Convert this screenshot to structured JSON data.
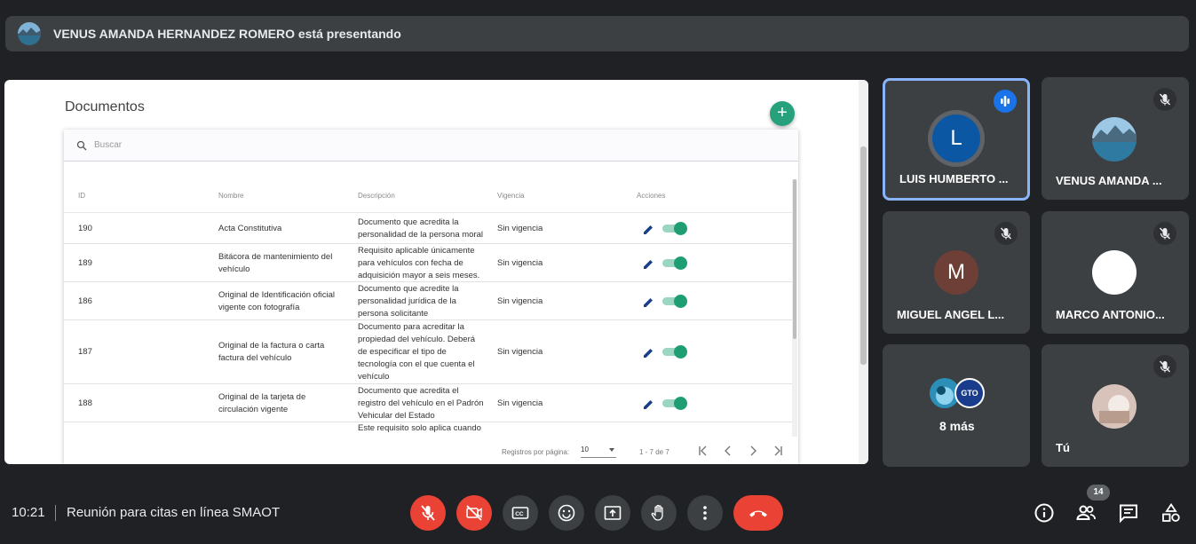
{
  "banner": {
    "text": "VENUS AMANDA HERNANDEZ ROMERO está presentando"
  },
  "shared": {
    "title": "Documentos",
    "add_label": "+",
    "search_placeholder": "Buscar",
    "columns": [
      "ID",
      "Nombre",
      "Descripción",
      "Vigencia",
      "Acciones"
    ],
    "rows": [
      {
        "id": "190",
        "name": [
          "Acta Constitutiva"
        ],
        "desc": [
          "Documento que acredita la",
          "personalidad de la persona moral"
        ],
        "vigencia": "Sin vigencia",
        "enabled": true
      },
      {
        "id": "189",
        "name": [
          "Bitácora de mantenimiento del",
          "vehículo"
        ],
        "desc": [
          "Requisito aplicable únicamente",
          "para vehículos con fecha de",
          "adquisición mayor a seis meses."
        ],
        "vigencia": "Sin vigencia",
        "enabled": true
      },
      {
        "id": "186",
        "name": [
          "Original de Identificación oficial",
          "vigente con fotografía"
        ],
        "desc": [
          "Documento que acredite la",
          "personalidad jurídica de la",
          "persona solicitante"
        ],
        "vigencia": "Sin vigencia",
        "enabled": true
      },
      {
        "id": "187",
        "name": [
          "Original de la factura o carta",
          "factura del vehículo"
        ],
        "desc": [
          "Documento para acreditar la",
          "propiedad del vehículo. Deberá",
          "de especificar el tipo de",
          "tecnología con el que cuenta el",
          "vehículo"
        ],
        "vigencia": "Sin vigencia",
        "enabled": true
      },
      {
        "id": "188",
        "name": [
          "Original de la tarjeta de",
          "circulación vigente"
        ],
        "desc": [
          "Documento que acredita el",
          "registro del vehículo en el Padrón",
          "Vehicular del Estado"
        ],
        "vigencia": "Sin vigencia",
        "enabled": true
      }
    ],
    "partial_row_text": "Este requisito solo aplica cuando",
    "footer": {
      "per_page_label": "Registros por página:",
      "per_page_value": "10",
      "range": "1 - 7 de 7"
    }
  },
  "participants": [
    {
      "name": "LUIS HUMBERTO ...",
      "initial": "L",
      "avatar_color": "#0b57a4",
      "speaking": true
    },
    {
      "name": "VENUS AMANDA ...",
      "initial": "",
      "avatar_color": "#6fa8c9",
      "speaking": false
    },
    {
      "name": "MIGUEL ANGEL L...",
      "initial": "M",
      "avatar_color": "#6d3f36",
      "speaking": false
    },
    {
      "name": "MARCO ANTONIO...",
      "initial": "",
      "avatar_color": "#ffffff",
      "speaking": false
    },
    {
      "name": "8 más",
      "initial": "",
      "avatar_color": "#3c4043",
      "speaking": false
    },
    {
      "name": "Tú",
      "initial": "",
      "avatar_color": "#d9c9c2",
      "speaking": false
    }
  ],
  "others_logo_text": "GTO",
  "bottom": {
    "time": "10:21",
    "meeting_name": "Reunión para citas en línea SMAOT",
    "participant_count": "14",
    "accent_red": "#ea4335",
    "icons": [
      "mic-off-icon",
      "camera-off-icon",
      "captions-icon",
      "emoji-icon",
      "present-icon",
      "raise-hand-icon",
      "more-options-icon",
      "end-call-icon",
      "info-icon",
      "people-icon",
      "chat-icon",
      "activities-icon"
    ]
  }
}
